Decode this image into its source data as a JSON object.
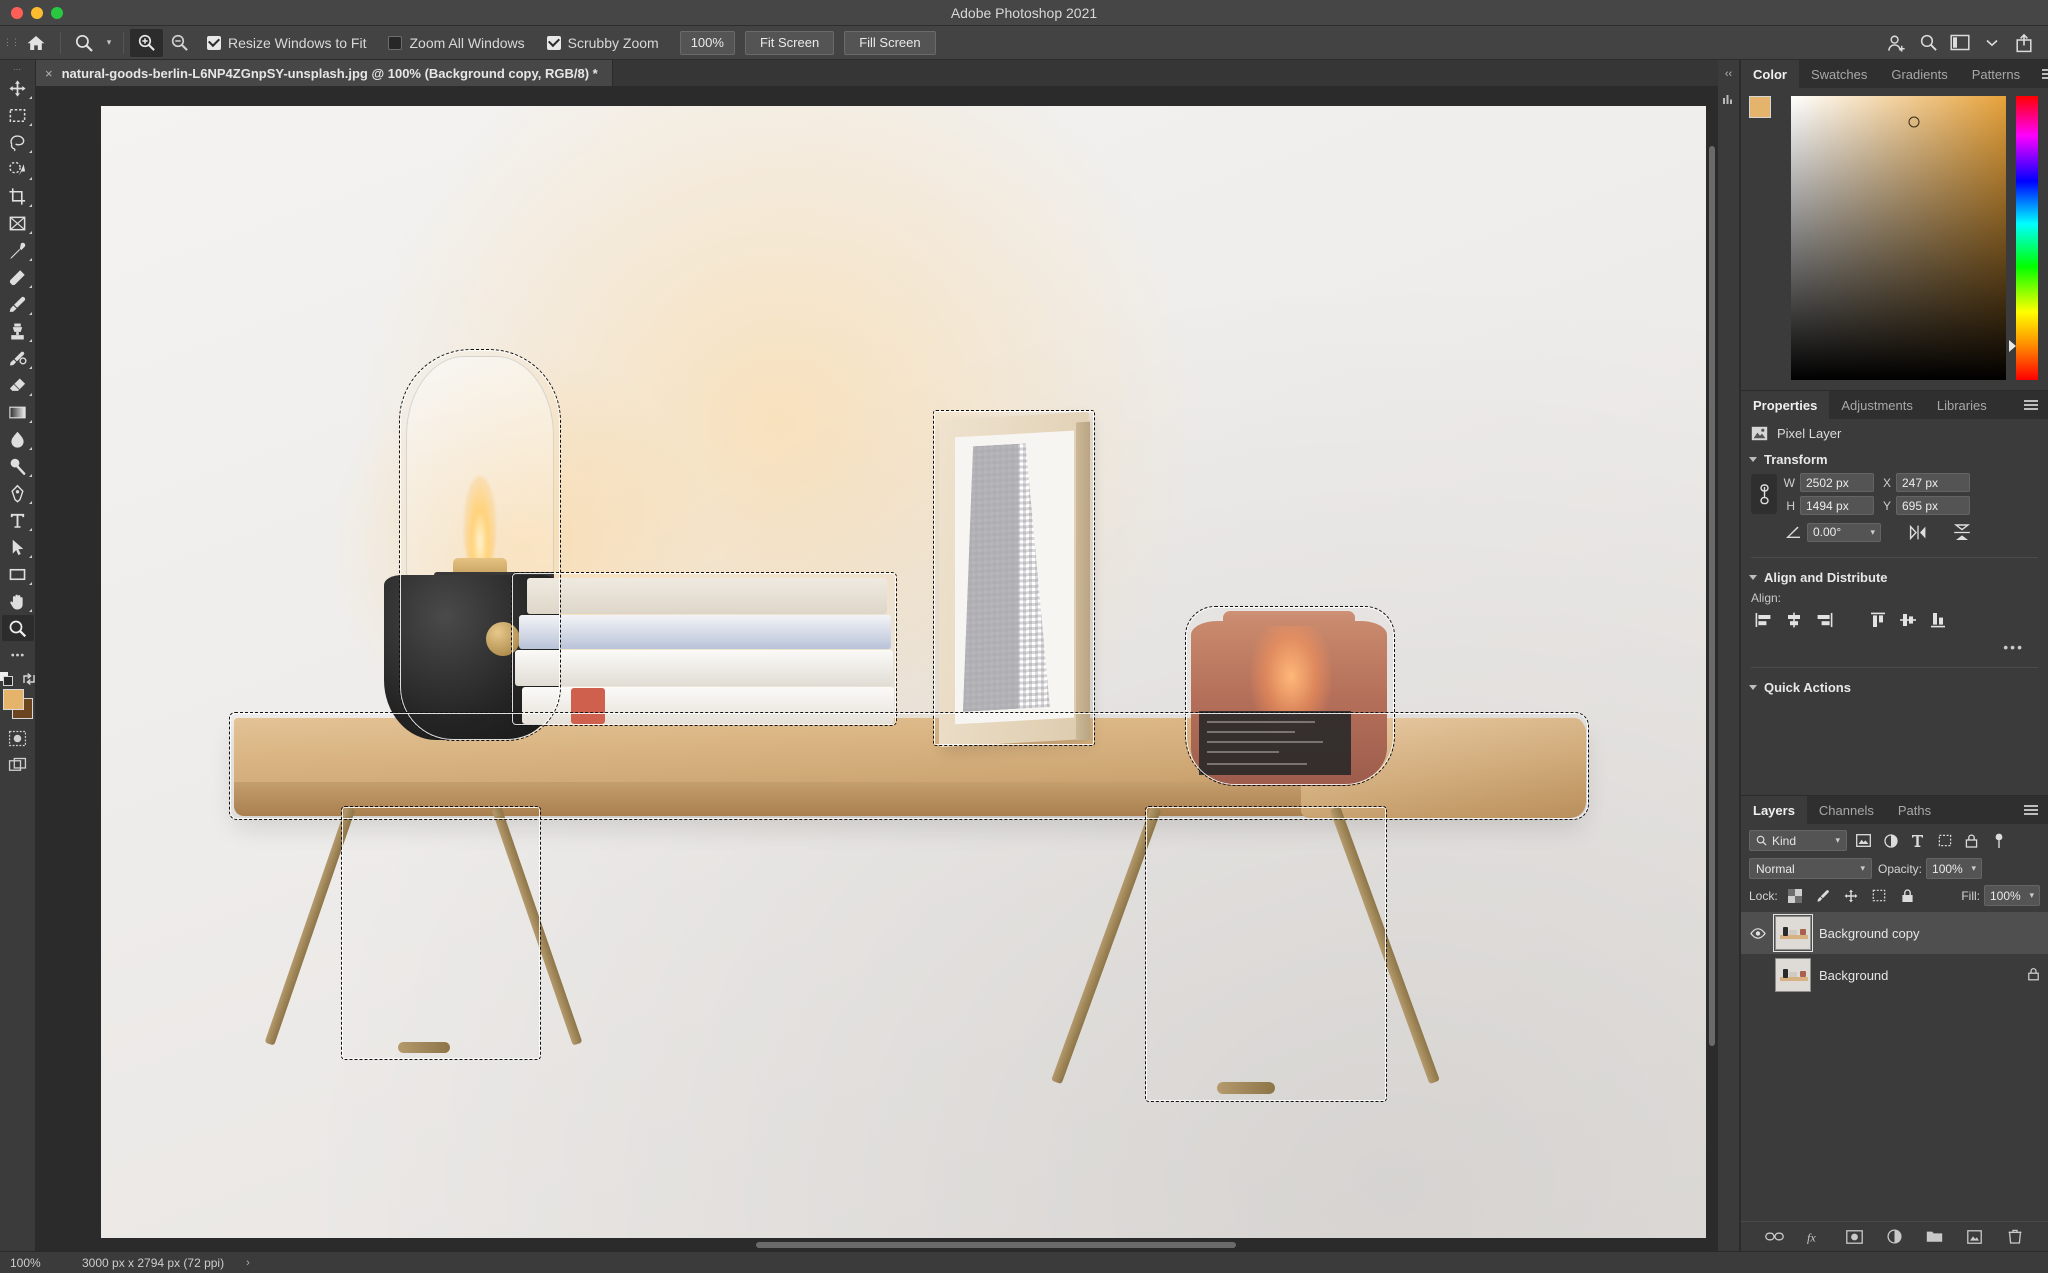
{
  "window": {
    "title": "Adobe Photoshop 2021"
  },
  "traffic": {
    "close": "close-window",
    "minimize": "minimize-window",
    "zoom": "zoom-window"
  },
  "options_bar": {
    "home_icon": "home-icon",
    "tool_icon": "zoom-tool-icon",
    "zoom_in_icon": "zoom-in-icon",
    "zoom_out_icon": "zoom-out-icon",
    "checkboxes": [
      {
        "label": "Resize Windows to Fit",
        "checked": true
      },
      {
        "label": "Zoom All Windows",
        "checked": false
      },
      {
        "label": "Scrubby Zoom",
        "checked": true
      }
    ],
    "zoom_value": "100%",
    "buttons": [
      "Fit Screen",
      "Fill Screen"
    ],
    "right_icons": [
      "add-collaborator-icon",
      "search-icon",
      "workspace-icon",
      "chevron-down-icon",
      "share-icon"
    ]
  },
  "toolbar": {
    "tools": [
      {
        "name": "move-tool",
        "selected": false
      },
      {
        "name": "rectangular-marquee-tool",
        "selected": false
      },
      {
        "name": "lasso-tool",
        "selected": false
      },
      {
        "name": "object-selection-tool",
        "selected": false
      },
      {
        "name": "crop-tool",
        "selected": false
      },
      {
        "name": "frame-tool",
        "selected": false
      },
      {
        "name": "eyedropper-tool",
        "selected": false
      },
      {
        "name": "spot-healing-brush-tool",
        "selected": false
      },
      {
        "name": "brush-tool",
        "selected": false
      },
      {
        "name": "clone-stamp-tool",
        "selected": false
      },
      {
        "name": "history-brush-tool",
        "selected": false
      },
      {
        "name": "eraser-tool",
        "selected": false
      },
      {
        "name": "gradient-tool",
        "selected": false
      },
      {
        "name": "blur-tool",
        "selected": false
      },
      {
        "name": "dodge-tool",
        "selected": false
      },
      {
        "name": "pen-tool",
        "selected": false
      },
      {
        "name": "type-tool",
        "selected": false
      },
      {
        "name": "path-selection-tool",
        "selected": false
      },
      {
        "name": "rectangle-tool",
        "selected": false
      },
      {
        "name": "hand-tool",
        "selected": false
      },
      {
        "name": "zoom-tool",
        "selected": true
      },
      {
        "name": "edit-toolbar-more",
        "selected": false
      }
    ],
    "foreground_color": "#e5b46a",
    "background_color": "#6b4420"
  },
  "document": {
    "tab_title": "natural-goods-berlin-L6NP4ZGnpSY-unsplash.jpg @ 100% (Background copy, RGB/8) *",
    "close_glyph": "×"
  },
  "color_panel": {
    "tabs": [
      {
        "label": "Color",
        "selected": true
      },
      {
        "label": "Swatches",
        "selected": false
      },
      {
        "label": "Gradients",
        "selected": false
      },
      {
        "label": "Patterns",
        "selected": false
      }
    ],
    "foreground_color": "#e4b36c",
    "background_color": "#5b3a1c"
  },
  "properties_panel": {
    "tabs": [
      {
        "label": "Properties",
        "selected": true
      },
      {
        "label": "Adjustments",
        "selected": false
      },
      {
        "label": "Libraries",
        "selected": false
      }
    ],
    "layer_kind": "Pixel Layer",
    "transform": {
      "title": "Transform",
      "w_label": "W",
      "w_value": "2502 px",
      "h_label": "H",
      "h_value": "1494 px",
      "x_label": "X",
      "x_value": "247 px",
      "y_label": "Y",
      "y_value": "695 px",
      "angle_value": "0.00°",
      "link_icon": "link-ratio-icon",
      "flip_h_icon": "flip-horizontal-icon",
      "flip_v_icon": "flip-vertical-icon"
    },
    "align": {
      "title": "Align and Distribute",
      "label": "Align:",
      "buttons": [
        "align-left-edges-icon",
        "align-horizontal-centers-icon",
        "align-right-edges-icon",
        "align-top-edges-icon",
        "align-vertical-centers-icon",
        "align-bottom-edges-icon"
      ],
      "more": "•••"
    },
    "quick_actions": {
      "title": "Quick Actions"
    }
  },
  "layers_panel": {
    "tabs": [
      {
        "label": "Layers",
        "selected": true
      },
      {
        "label": "Channels",
        "selected": false
      },
      {
        "label": "Paths",
        "selected": false
      }
    ],
    "filter_kind": "Kind",
    "filter_icons": [
      "filter-pixel-icon",
      "filter-adjustment-icon",
      "filter-type-icon",
      "filter-shape-icon",
      "filter-smart-object-icon",
      "filter-toggle-icon"
    ],
    "blend_mode": "Normal",
    "opacity_label": "Opacity:",
    "opacity_value": "100%",
    "lock_label": "Lock:",
    "lock_icons": [
      "lock-transparent-pixels-icon",
      "lock-image-pixels-icon",
      "lock-position-icon",
      "lock-artboard-nesting-icon",
      "lock-all-icon"
    ],
    "fill_label": "Fill:",
    "fill_value": "100%",
    "layers": [
      {
        "name": "Background copy",
        "visible": true,
        "selected": true,
        "locked": false
      },
      {
        "name": "Background",
        "visible": false,
        "selected": false,
        "locked": true
      }
    ],
    "bottom_icons": [
      "link-layers-icon",
      "layer-style-fx-icon",
      "add-mask-icon",
      "new-adjustment-layer-icon",
      "new-group-icon",
      "new-layer-icon",
      "delete-layer-icon"
    ]
  },
  "status_bar": {
    "zoom": "100%",
    "dimensions": "3000 px x 2794 px (72 ppi)",
    "arrow": "›"
  },
  "canvas": {
    "image_description": "wall-mounted wooden shelf with lantern lamp, stack of books, framed picture and candle jar",
    "selection_active": true
  }
}
